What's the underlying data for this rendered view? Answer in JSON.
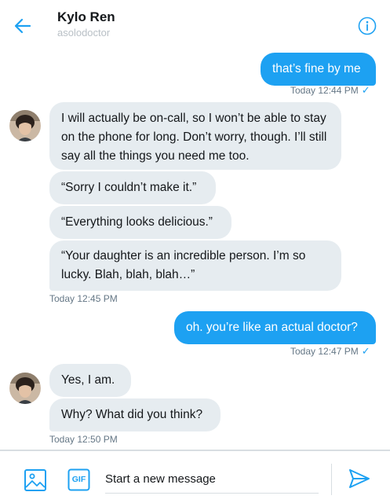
{
  "header": {
    "title": "Kylo Ren",
    "subtitle": "asolodoctor",
    "back_icon": "arrow-left-icon",
    "info_icon": "info-icon"
  },
  "messages": [
    {
      "dir": "out",
      "text": "that’s fine by me"
    },
    {
      "meta": "Today 12:44 PM",
      "read": true
    },
    {
      "dir": "in",
      "text": "I will actually be on-call, so I won’t be able to stay on the phone for long. Don’t worry, though. I’ll still say all the things you need me too."
    },
    {
      "dir": "in",
      "text": "“Sorry I couldn’t make it.”"
    },
    {
      "dir": "in",
      "text": "“Everything looks delicious.”"
    },
    {
      "dir": "in",
      "text": "“Your daughter is an incredible person. I’m so lucky. Blah, blah, blah…”"
    },
    {
      "meta": "Today 12:45 PM",
      "read": false
    },
    {
      "dir": "out",
      "text": "oh. you’re like an actual doctor?"
    },
    {
      "meta": "Today 12:47 PM",
      "read": true
    },
    {
      "dir": "in",
      "text": "Yes, I am."
    },
    {
      "dir": "in",
      "text": "Why? What did you think?"
    },
    {
      "meta": "Today 12:50 PM",
      "read": false
    }
  ],
  "composer": {
    "placeholder": "Start a new message",
    "media_icon": "image-icon",
    "gif_label": "GIF",
    "send_icon": "send-icon"
  },
  "colors": {
    "accent": "#1da1f2",
    "incoming_bubble": "#e6ecf0",
    "meta_text": "#657786"
  }
}
